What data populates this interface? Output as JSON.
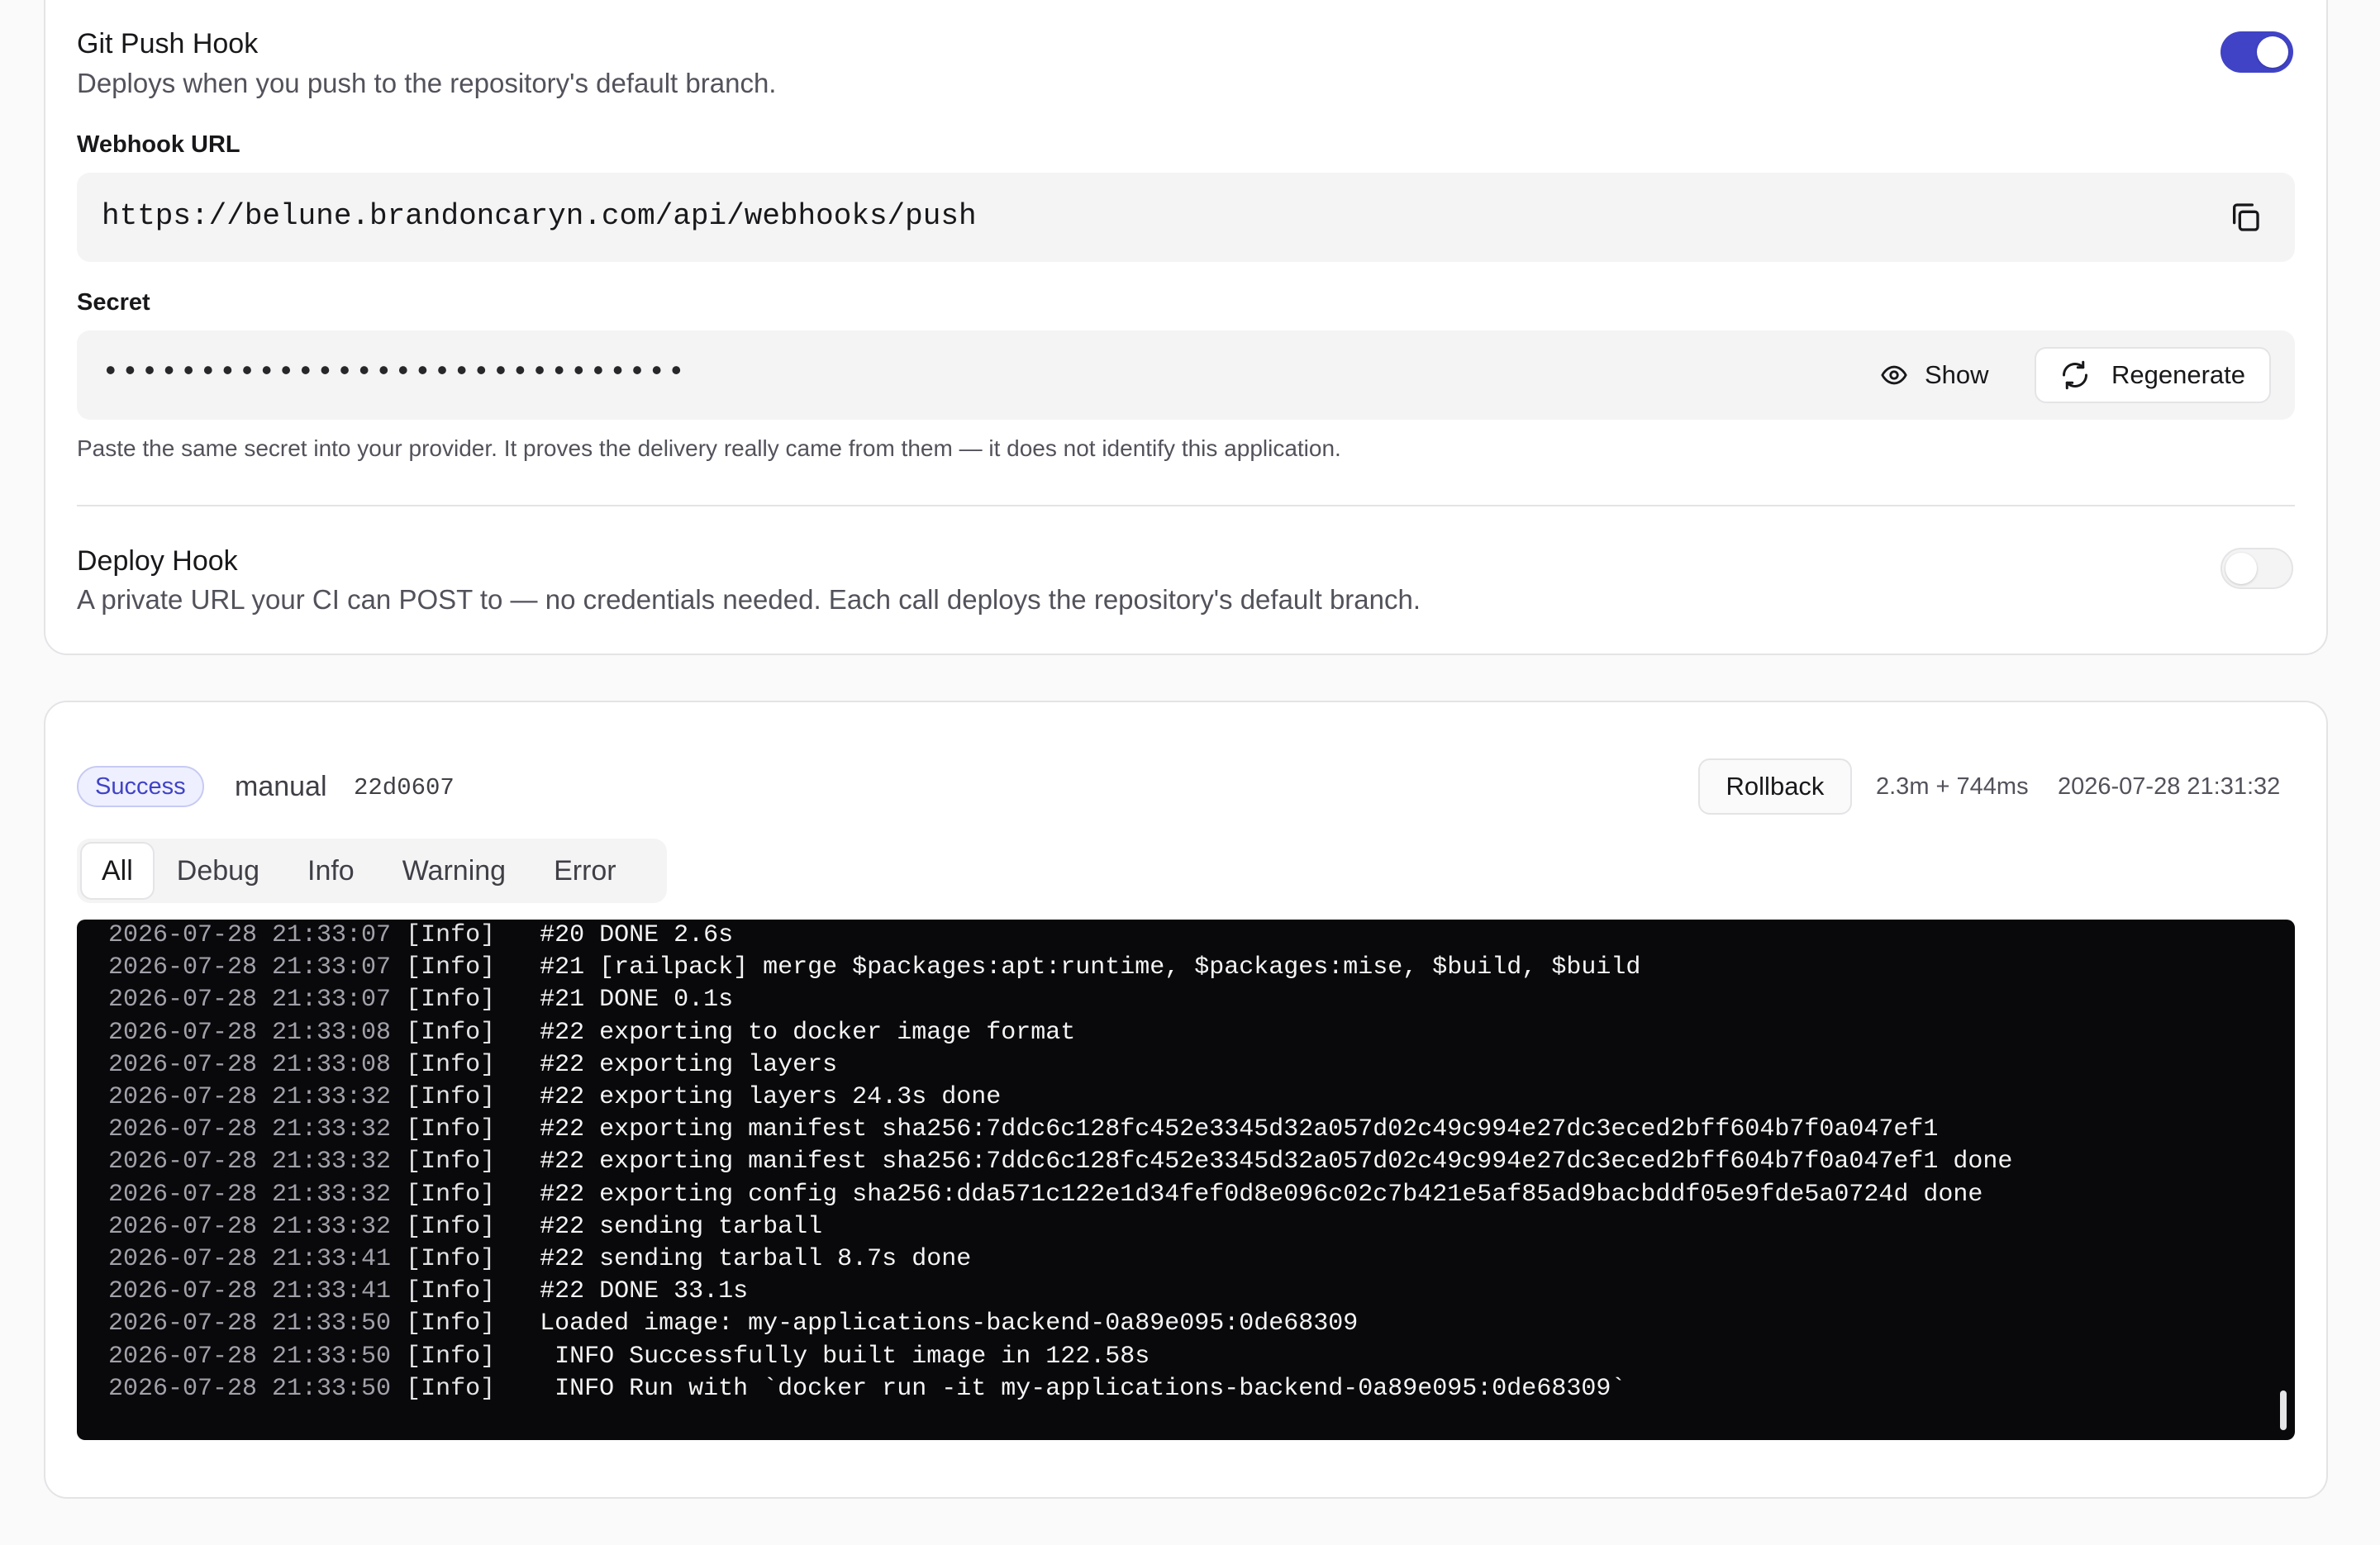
{
  "git_push_hook": {
    "title": "Git Push Hook",
    "description": "Deploys when you push to the repository's default branch.",
    "enabled": true,
    "webhook_label": "Webhook URL",
    "webhook_url": "https://belune.brandoncaryn.com/api/webhooks/push",
    "secret_label": "Secret",
    "secret_masked": "••••••••••••••••••••••••••••••",
    "show_label": "Show",
    "regenerate_label": "Regenerate",
    "secret_hint": "Paste the same secret into your provider. It proves the delivery really came from them — it does not identify this application."
  },
  "deploy_hook": {
    "title": "Deploy Hook",
    "description": "A private URL your CI can POST to — no credentials needed. Each call deploys the repository's default branch.",
    "enabled": false
  },
  "deployment": {
    "status": "Success",
    "trigger": "manual",
    "commit": "22d0607",
    "rollback_label": "Rollback",
    "duration": "2.3m + 744ms",
    "timestamp": "2026-07-28 21:31:32"
  },
  "log_filter_tabs": [
    {
      "label": "All",
      "active": true
    },
    {
      "label": "Debug",
      "active": false
    },
    {
      "label": "Info",
      "active": false
    },
    {
      "label": "Warning",
      "active": false
    },
    {
      "label": "Error",
      "active": false
    }
  ],
  "logs": [
    {
      "ts": "2026-07-28 21:33:07",
      "level": "[Info]",
      "msg": "   #20 DONE 2.6s"
    },
    {
      "ts": "2026-07-28 21:33:07",
      "level": "[Info]",
      "msg": "   #21 [railpack] merge $packages:apt:runtime, $packages:mise, $build, $build"
    },
    {
      "ts": "2026-07-28 21:33:07",
      "level": "[Info]",
      "msg": "   #21 DONE 0.1s"
    },
    {
      "ts": "2026-07-28 21:33:08",
      "level": "[Info]",
      "msg": "   #22 exporting to docker image format"
    },
    {
      "ts": "2026-07-28 21:33:08",
      "level": "[Info]",
      "msg": "   #22 exporting layers"
    },
    {
      "ts": "2026-07-28 21:33:32",
      "level": "[Info]",
      "msg": "   #22 exporting layers 24.3s done"
    },
    {
      "ts": "2026-07-28 21:33:32",
      "level": "[Info]",
      "msg": "   #22 exporting manifest sha256:7ddc6c128fc452e3345d32a057d02c49c994e27dc3eced2bff604b7f0a047ef1"
    },
    {
      "ts": "2026-07-28 21:33:32",
      "level": "[Info]",
      "msg": "   #22 exporting manifest sha256:7ddc6c128fc452e3345d32a057d02c49c994e27dc3eced2bff604b7f0a047ef1 done"
    },
    {
      "ts": "2026-07-28 21:33:32",
      "level": "[Info]",
      "msg": "   #22 exporting config sha256:dda571c122e1d34fef0d8e096c02c7b421e5af85ad9bacbddf05e9fde5a0724d done"
    },
    {
      "ts": "2026-07-28 21:33:32",
      "level": "[Info]",
      "msg": "   #22 sending tarball"
    },
    {
      "ts": "2026-07-28 21:33:41",
      "level": "[Info]",
      "msg": "   #22 sending tarball 8.7s done"
    },
    {
      "ts": "2026-07-28 21:33:41",
      "level": "[Info]",
      "msg": "   #22 DONE 33.1s"
    },
    {
      "ts": "2026-07-28 21:33:50",
      "level": "[Info]",
      "msg": "   Loaded image: my-applications-backend-0a89e095:0de68309"
    },
    {
      "ts": "2026-07-28 21:33:50",
      "level": "[Info]",
      "msg": "    INFO Successfully built image in 122.58s"
    },
    {
      "ts": "2026-07-28 21:33:50",
      "level": "[Info]",
      "msg": "    INFO Run with `docker run -it my-applications-backend-0a89e095:0de68309`"
    }
  ],
  "icons": {
    "copy": "copy-icon",
    "eye": "eye-icon",
    "refresh": "refresh-icon"
  },
  "colors": {
    "accent": "#4043c6",
    "console_bg": "#09090b"
  }
}
